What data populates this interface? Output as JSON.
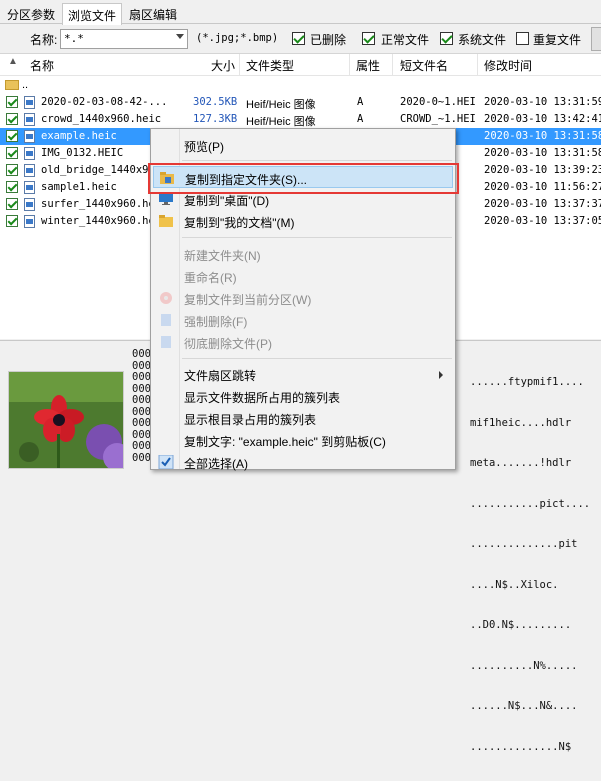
{
  "tabs": [
    "分区参数",
    "浏览文件",
    "扇区编辑"
  ],
  "filter": {
    "name_label": "名称:",
    "name_value": "*.*",
    "ext_hint": "(*.jpg;*.bmp)",
    "checks": [
      {
        "label": "已删除",
        "checked": true
      },
      {
        "label": "正常文件",
        "checked": true
      },
      {
        "label": "系统文件",
        "checked": true
      },
      {
        "label": "重复文件",
        "checked": false
      }
    ]
  },
  "columns": [
    "名称",
    "大小",
    "文件类型",
    "属性",
    "短文件名",
    "修改时间"
  ],
  "parent_row": "..",
  "files": [
    {
      "name": "2020-02-03-08-42-...",
      "size": "302.5KB",
      "type": "Heif/Heic 图像",
      "attr": "A",
      "short": "2020-0~1.HEI",
      "mtime": "2020-03-10  13:31:59",
      "selected": false
    },
    {
      "name": "crowd_1440x960.heic",
      "size": "127.3KB",
      "type": "Heif/Heic 图像",
      "attr": "A",
      "short": "CROWD_~1.HEI",
      "mtime": "2020-03-10  13:42:41",
      "selected": false
    },
    {
      "name": "example.heic",
      "size": "",
      "type": "",
      "attr": "",
      "short": "",
      "mtime": "2020-03-10  13:31:58",
      "selected": true
    },
    {
      "name": "IMG_0132.HEIC",
      "size": "",
      "type": "",
      "attr": "",
      "short": "",
      "mtime": "2020-03-10  13:31:58",
      "selected": false
    },
    {
      "name": "old_bridge_1440x9...",
      "size": "",
      "type": "",
      "attr": "",
      "short": "",
      "mtime": "2020-03-10  13:39:23",
      "selected": false
    },
    {
      "name": "sample1.heic",
      "size": "",
      "type": "",
      "attr": "",
      "short": "",
      "mtime": "2020-03-10  11:56:27",
      "selected": false
    },
    {
      "name": "surfer_1440x960.he",
      "size": "",
      "type": "",
      "attr": "",
      "short": "",
      "mtime": "2020-03-10  13:37:37",
      "selected": false
    },
    {
      "name": "winter_1440x960.he",
      "size": "",
      "type": "",
      "attr": "",
      "short": "",
      "mtime": "2020-03-10  13:37:05",
      "selected": false
    }
  ],
  "hex_offsets": [
    "000",
    "000",
    "000",
    "000",
    "000",
    "000",
    "000",
    "000",
    "000",
    "000"
  ],
  "ascii_lines": [
    "......ftypmif1....",
    "mif1heic....hdlr",
    "meta.......!hdlr",
    "...........pict....",
    "..............pit",
    "....N$..Xiloc.",
    "..D0.N$.........",
    "..........N%.....",
    "......N$...N&....",
    "..............N$"
  ],
  "context_menu": {
    "items": [
      {
        "label": "预览(P)",
        "disabled": false,
        "icon": ""
      },
      {
        "sep": true
      },
      {
        "label": "复制到指定文件夹(S)...",
        "disabled": false,
        "icon": "copy-folder-icon",
        "highlight": true
      },
      {
        "label": "复制到\"桌面\"(D)",
        "disabled": false,
        "icon": "desktop-icon"
      },
      {
        "label": "复制到\"我的文档\"(M)",
        "disabled": false,
        "icon": "documents-folder-icon"
      },
      {
        "sep": true
      },
      {
        "label": "新建文件夹(N)",
        "disabled": true,
        "icon": ""
      },
      {
        "label": "重命名(R)",
        "disabled": true,
        "icon": ""
      },
      {
        "label": "复制文件到当前分区(W)",
        "disabled": true,
        "icon": "disk-copy-icon"
      },
      {
        "label": "强制删除(F)",
        "disabled": true,
        "icon": "force-delete-icon"
      },
      {
        "label": "彻底删除文件(P)",
        "disabled": true,
        "icon": "permanent-delete-icon"
      },
      {
        "sep": true
      },
      {
        "label": "文件扇区跳转",
        "disabled": false,
        "icon": "",
        "submenu": true
      },
      {
        "label": "显示文件数据所占用的簇列表",
        "disabled": false,
        "icon": ""
      },
      {
        "label": "显示根目录占用的簇列表",
        "disabled": false,
        "icon": ""
      },
      {
        "label": "复制文字: \"example.heic\" 到剪贴板(C)",
        "disabled": false,
        "icon": ""
      },
      {
        "label": "全部选择(A)",
        "disabled": false,
        "icon": "check-icon"
      }
    ]
  },
  "colors": {
    "selection": "#3399ff",
    "highlight_box": "#e53935",
    "menu_hover": "#cce4f7"
  }
}
